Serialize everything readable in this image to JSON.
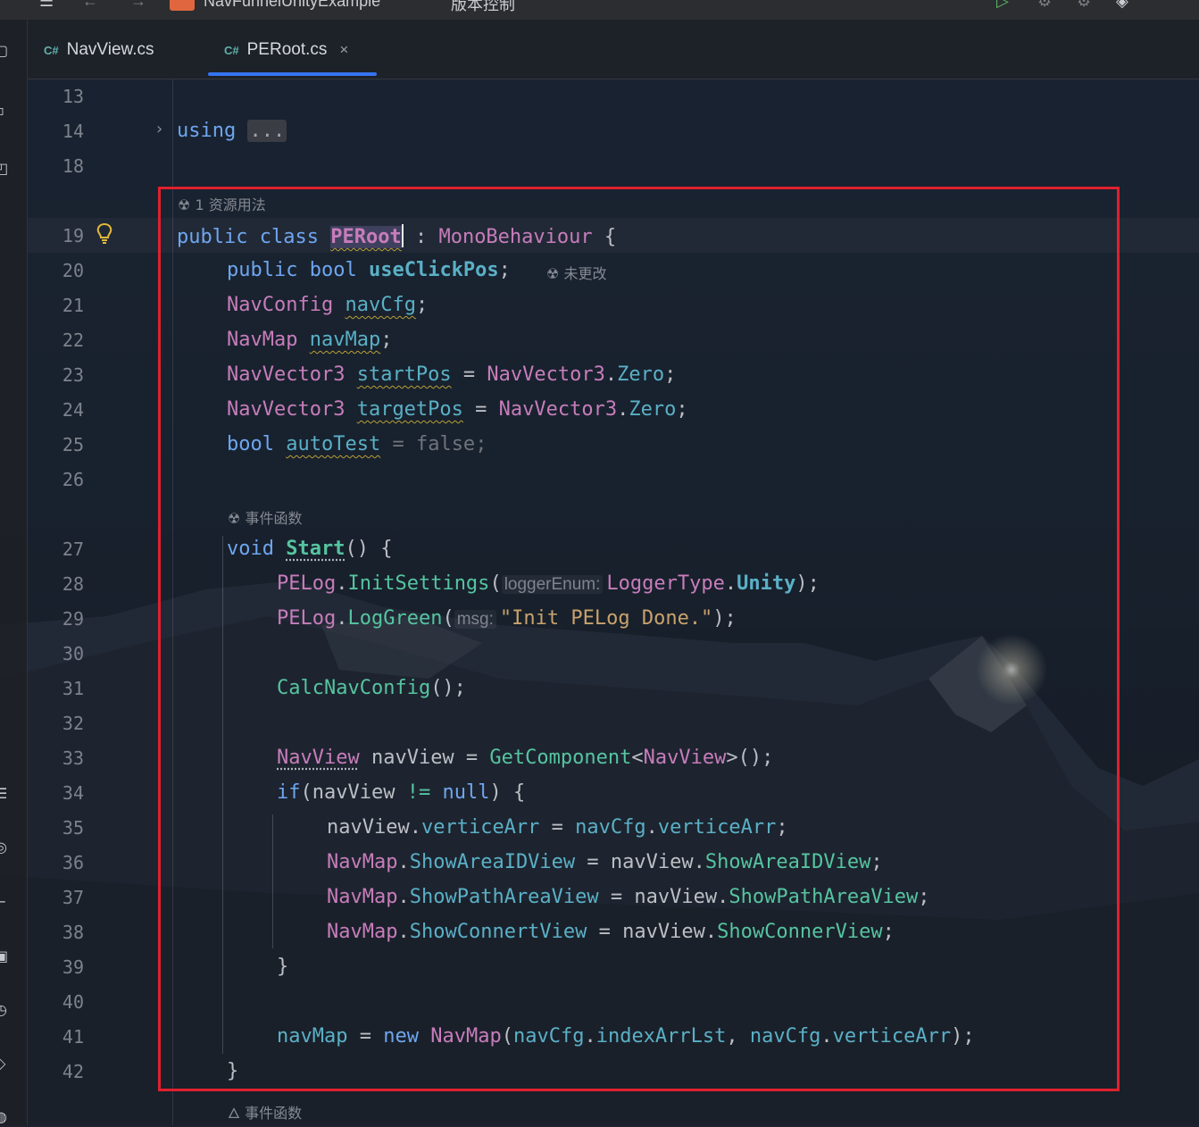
{
  "window": {
    "project_name": "NavFunnelUnityExample",
    "vcs_label": "版本控制"
  },
  "tabs": [
    {
      "icon": "C#",
      "label": "NavView.cs",
      "active": false
    },
    {
      "icon": "C#",
      "label": "PERoot.cs",
      "active": true,
      "close": "×"
    }
  ],
  "colors": {
    "accent": "#3574f0",
    "highlight_box": "#e0202e",
    "keyword": "#6ea6f0",
    "type": "#c77dbb",
    "method": "#56c4a0",
    "string": "#c9a26d",
    "property": "#5ab0c6"
  },
  "hints": {
    "class_usage": "1 资源用法",
    "unchanged": "未更改",
    "event_function_1": "事件函数",
    "event_function_2": "事件函数"
  },
  "inlay_hints": {
    "logger_enum": "loggerEnum:",
    "msg": "msg:"
  },
  "line_numbers": [
    "13",
    "14",
    "18",
    "19",
    "20",
    "21",
    "22",
    "23",
    "24",
    "25",
    "26",
    "27",
    "28",
    "29",
    "30",
    "31",
    "32",
    "33",
    "34",
    "35",
    "36",
    "37",
    "38",
    "39",
    "40",
    "41",
    "42"
  ],
  "code": {
    "l14_using": "using",
    "l14_fold": "...",
    "l19": {
      "public": "public",
      "class": "class",
      "name": "PERoot",
      "colon": " : ",
      "base": "MonoBehaviour",
      "brace": " {"
    },
    "l20": {
      "public": "public",
      "bool": "bool",
      "field": "useClickPos",
      "semi": ";"
    },
    "l21": {
      "type": "NavConfig",
      "field": "navCfg",
      "semi": ";"
    },
    "l22": {
      "type": "NavMap",
      "field": "navMap",
      "semi": ";"
    },
    "l23": {
      "type": "NavVector3",
      "field": "startPos",
      "eq": " = ",
      "type2": "NavVector3",
      "dot": ".",
      "prop": "Zero",
      "semi": ";"
    },
    "l24": {
      "type": "NavVector3",
      "field": "targetPos",
      "eq": " = ",
      "type2": "NavVector3",
      "dot": ".",
      "prop": "Zero",
      "semi": ";"
    },
    "l25": {
      "bool": "bool",
      "field": "autoTest",
      "eq": " = ",
      "val": "false",
      "semi": ";"
    },
    "l27": {
      "void": "void",
      "method": "Start",
      "rest": "() {"
    },
    "l28": {
      "cls": "PELog",
      "dot": ".",
      "method": "InitSettings",
      "open": "(",
      "type": "LoggerType",
      "dot2": ".",
      "enum": "Unity",
      "close": ");"
    },
    "l29": {
      "cls": "PELog",
      "dot": ".",
      "method": "LogGreen",
      "open": "(",
      "str": "\"Init PELog Done.\"",
      "close": ");"
    },
    "l31": {
      "method": "CalcNavConfig",
      "rest": "();"
    },
    "l33": {
      "type": "NavView",
      "var": " navView = ",
      "method": "GetComponent",
      "lt": "<",
      "type2": "NavView",
      "rest": ">();"
    },
    "l34": {
      "if": "if",
      "open": "(navView ",
      "neq": "!=",
      "sp": " ",
      "null": "null",
      "rest": ") {"
    },
    "l35": {
      "var": "navView",
      "dot": ".",
      "prop": "verticeArr",
      "eq": " = ",
      "src": "navCfg",
      "dot2": ".",
      "prop2": "verticeArr",
      "semi": ";"
    },
    "l36": {
      "type": "NavMap",
      "dot": ".",
      "prop": "ShowAreaIDView",
      "eq": " = ",
      "src": "navView",
      "dot2": ".",
      "method": "ShowAreaIDView",
      "semi": ";"
    },
    "l37": {
      "type": "NavMap",
      "dot": ".",
      "prop": "ShowPathAreaView",
      "eq": " = ",
      "src": "navView",
      "dot2": ".",
      "method": "ShowPathAreaView",
      "semi": ";"
    },
    "l38": {
      "type": "NavMap",
      "dot": ".",
      "prop": "ShowConnertView",
      "eq": " = ",
      "src": "navView",
      "dot2": ".",
      "method": "ShowConnerView",
      "semi": ";"
    },
    "l39": "}",
    "l41": {
      "var": "navMap",
      "eq": " = ",
      "new": "new",
      "sp": " ",
      "type": "NavMap",
      "open": "(",
      "a": "navCfg",
      "dot": ".",
      "p1": "indexArrLst",
      "comma": ", ",
      "b": "navCfg",
      "dot2": ".",
      "p2": "verticeArr",
      "close": ");"
    },
    "l42": "}"
  }
}
